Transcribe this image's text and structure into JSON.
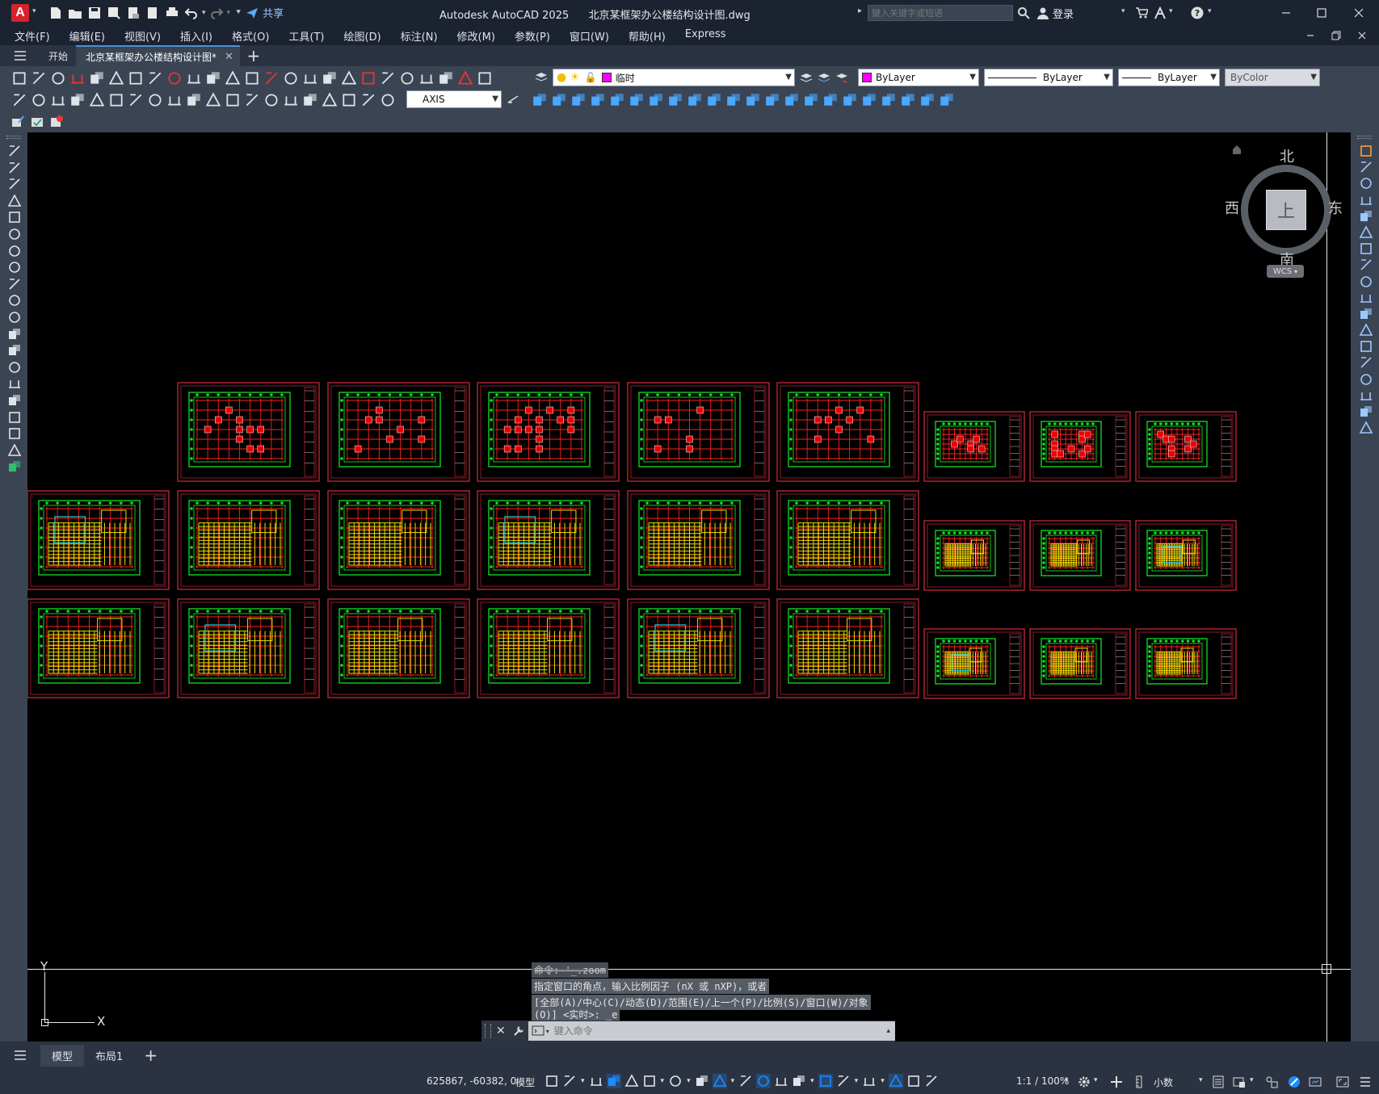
{
  "title": {
    "app_name": "Autodesk AutoCAD 2025",
    "file_name": "北京某框架办公楼结构设计图.dwg",
    "share_label": "共享",
    "search_placeholder": "键入关键字或短语",
    "login_label": "登录"
  },
  "menu": [
    "文件(F)",
    "编辑(E)",
    "视图(V)",
    "插入(I)",
    "格式(O)",
    "工具(T)",
    "绘图(D)",
    "标注(N)",
    "修改(M)",
    "参数(P)",
    "窗口(W)",
    "帮助(H)",
    "Express"
  ],
  "tabs": {
    "start": "开始",
    "document": "北京某框架办公楼结构设计图*"
  },
  "toolbar": {
    "layer_name": "临时",
    "color_value": "ByLayer",
    "linetype_value": "ByLayer",
    "lineweight_value": "ByLayer",
    "plotstyle_value": "ByColor",
    "dimstyle_value": "AXIS"
  },
  "viewcube": {
    "north": "北",
    "south": "南",
    "east": "东",
    "west": "西",
    "face": "上",
    "ucs_label": "WCS"
  },
  "ucs_icon": {
    "x_label": "X",
    "y_label": "Y"
  },
  "command": {
    "history": [
      "命令: '_.zoom",
      "指定窗口的角点，输入比例因子 (nX 或 nXP)，或者",
      "[全部(A)/中心(C)/动态(D)/范围(E)/上一个(P)/比例(S)/窗口(W)/对象",
      "(O)] <实时>: _e"
    ],
    "placeholder": "键入命令"
  },
  "layout_tabs": {
    "model": "模型",
    "layout1": "布局1"
  },
  "status": {
    "coords": "625867, -60382, 0",
    "space": "模型",
    "scale": "1:1 / 100%",
    "units": "小数"
  },
  "colors": {
    "canvas_bg": "#000000",
    "sheet_frame": "#aa2233",
    "grid_red": "#ff2020",
    "grid_green": "#10e020",
    "beam_yellow": "#e8e000",
    "cyan": "#20d0e0",
    "accent_blue": "#1a8cff",
    "autocad_red": "#d8222b"
  }
}
